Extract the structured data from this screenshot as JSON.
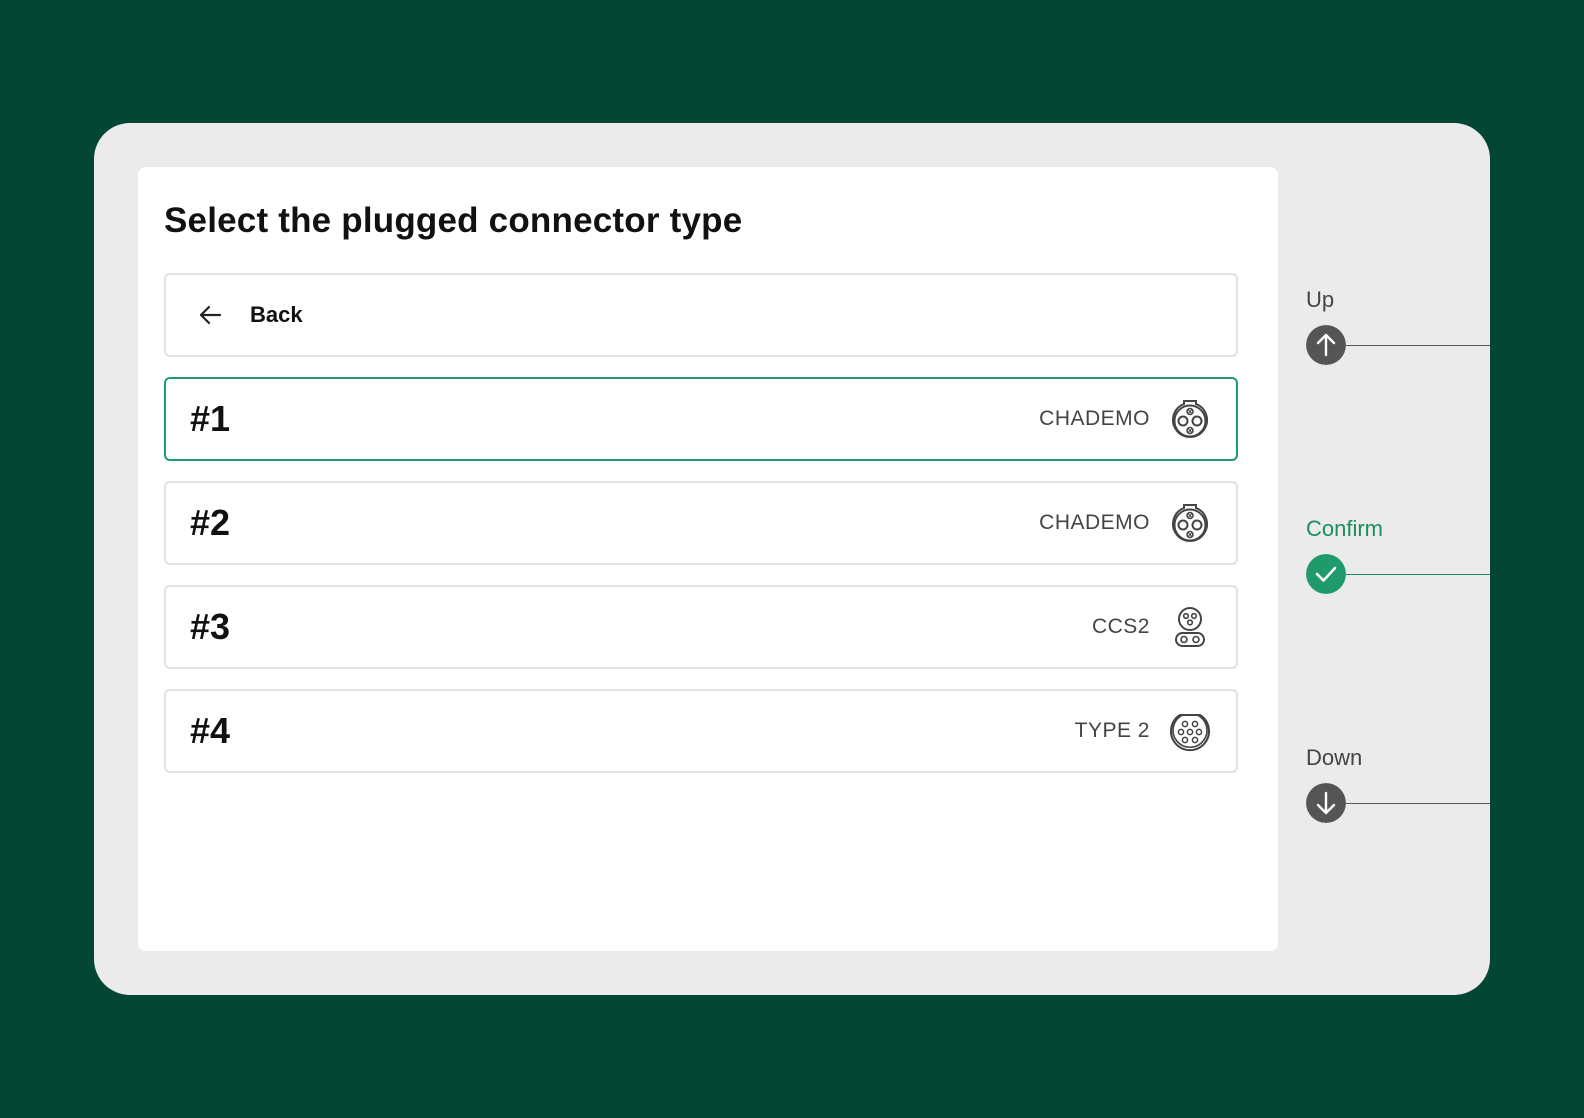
{
  "page": {
    "title": "Select the plugged connector type",
    "back_label": "Back"
  },
  "connectors": [
    {
      "number": "#1",
      "type": "CHADEMO",
      "icon": "chademo-connector-icon",
      "selected": true
    },
    {
      "number": "#2",
      "type": "CHADEMO",
      "icon": "chademo-connector-icon",
      "selected": false
    },
    {
      "number": "#3",
      "type": "CCS2",
      "icon": "ccs2-connector-icon",
      "selected": false
    },
    {
      "number": "#4",
      "type": "TYPE 2",
      "icon": "type2-connector-icon",
      "selected": false
    }
  ],
  "controls": {
    "up_label": "Up",
    "confirm_label": "Confirm",
    "down_label": "Down"
  },
  "colors": {
    "background": "#034634",
    "accent": "#1f9a6a",
    "device": "#ebebeb",
    "button_dark": "#555555"
  }
}
